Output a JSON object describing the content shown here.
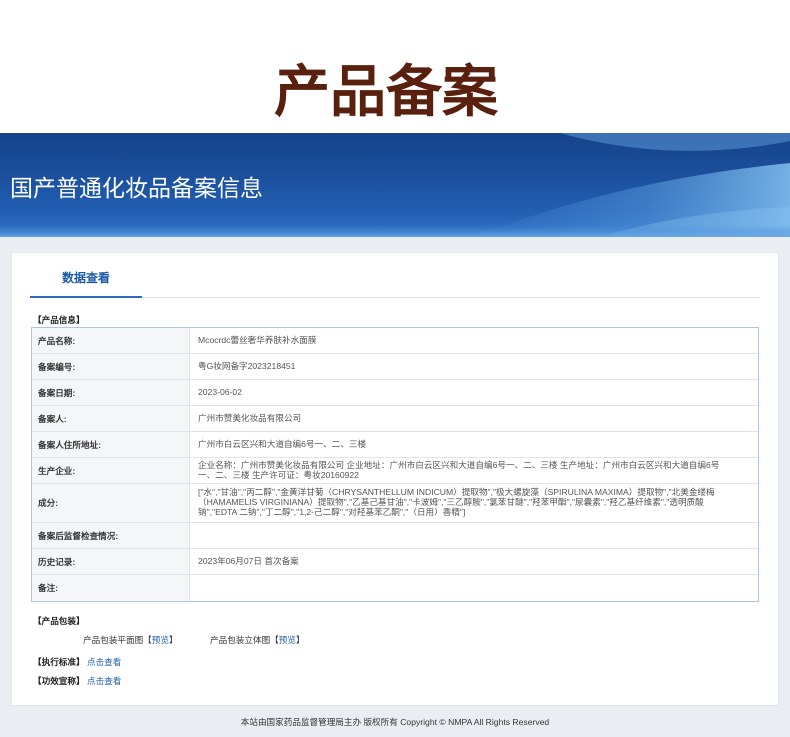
{
  "page_title": "产品备案",
  "banner": {
    "title": "国产普通化妆品备案信息"
  },
  "tabs": [
    {
      "label": "数据查看",
      "active": true
    }
  ],
  "product_info": {
    "title": "【产品信息】",
    "rows": [
      {
        "label": "产品名称:",
        "value": "Mcocrdc蕾丝奢华养肤补水面膜"
      },
      {
        "label": "备案编号:",
        "value": "粤G妆网备字2023218451"
      },
      {
        "label": "备案日期:",
        "value": "2023-06-02"
      },
      {
        "label": "备案人:",
        "value": "广州市赞美化妆品有限公司"
      },
      {
        "label": "备案人住所地址:",
        "value": "广州市白云区兴和大道自编6号一、二、三楼"
      },
      {
        "label": "生产企业:",
        "value": "企业名称：广州市赞美化妆品有限公司 企业地址：广州市白云区兴和大道自编6号一、二、三楼 生产地址：广州市白云区兴和大道自编6号一、二、三楼 生产许可证：粤妆20160922"
      },
      {
        "label": "成分:",
        "value": "[\"水\",\"甘油\",\"丙二醇\",\"金黄洋甘菊（CHRYSANTHELLUM INDICUM）提取物\",\"极大螺旋藻（SPIRULINA MAXIMA）提取物\",\"北美金缕梅（HAMAMELIS VIRGINIANA）提取物\",\"乙基己基甘油\",\"卡波姆\",\"三乙醇胺\",\"氯苯甘醚\",\"羟苯甲酯\",\"尿囊素\",\"羟乙基纤维素\",\"透明质酸钠\",\"EDTA 二钠\",\"丁二醇\",\"1,2-己二醇\",\"对羟基苯乙酮\",\"（日用）香精\"]"
      },
      {
        "label": "备案后监督检查情况:",
        "value": ""
      },
      {
        "label": "历史记录:",
        "value": "2023年06月07日 首次备案"
      },
      {
        "label": "备注:",
        "value": ""
      }
    ]
  },
  "packaging": {
    "title": "【产品包装】",
    "items": [
      {
        "label": "产品包装平面图",
        "open": "【",
        "link": "预览",
        "close": "】"
      },
      {
        "label": "产品包装立体图",
        "open": "【",
        "link": "预览",
        "close": "】"
      }
    ]
  },
  "execution_standard": {
    "title": "【执行标准】",
    "link": "点击查看"
  },
  "efficacy_claim": {
    "title": "【功效宣称】",
    "link": "点击查看"
  },
  "footer": {
    "text": "本站由国家药品监督管理局主办 版权所有 Copyright © NMPA All Rights Reserved"
  },
  "colors": {
    "title": "#5a200e",
    "accent": "#2a6cc0",
    "tab_text": "#1d5ba8",
    "link": "#2260b0",
    "table_border": "#a9c6e4",
    "page_bg": "#eaeef3"
  }
}
